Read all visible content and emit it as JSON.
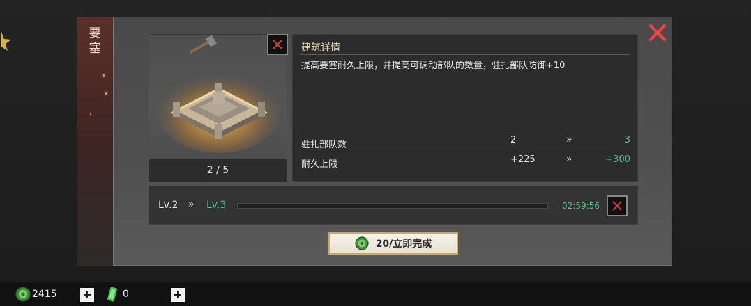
{
  "side_tab": {
    "title": "要\n塞"
  },
  "building": {
    "count_label": "2 / 5"
  },
  "detail": {
    "title": "建筑详情",
    "description": "提高要塞耐久上限，并提高可调动部队的数量，驻扎部队防御+10",
    "stats": [
      {
        "label": "驻扎部队数",
        "current": "2",
        "arrow": "»",
        "next": "3"
      },
      {
        "label": "耐久上限",
        "current": "+225",
        "arrow": "»",
        "next": "+300"
      }
    ]
  },
  "upgrade": {
    "current_level": "Lv.2",
    "arrow": "»",
    "next_level": "Lv.3",
    "timer": "02:59:56",
    "progress": 0.0
  },
  "complete_button": {
    "label": "20/立即完成"
  },
  "resources": [
    {
      "icon": "jade-coin-icon",
      "value": "2415"
    },
    {
      "icon": "green-token-icon",
      "value": "0"
    }
  ],
  "colors": {
    "accent_green": "#4fc08a",
    "close_red": "#d23a3a",
    "title_gold": "#e8d7b8"
  }
}
